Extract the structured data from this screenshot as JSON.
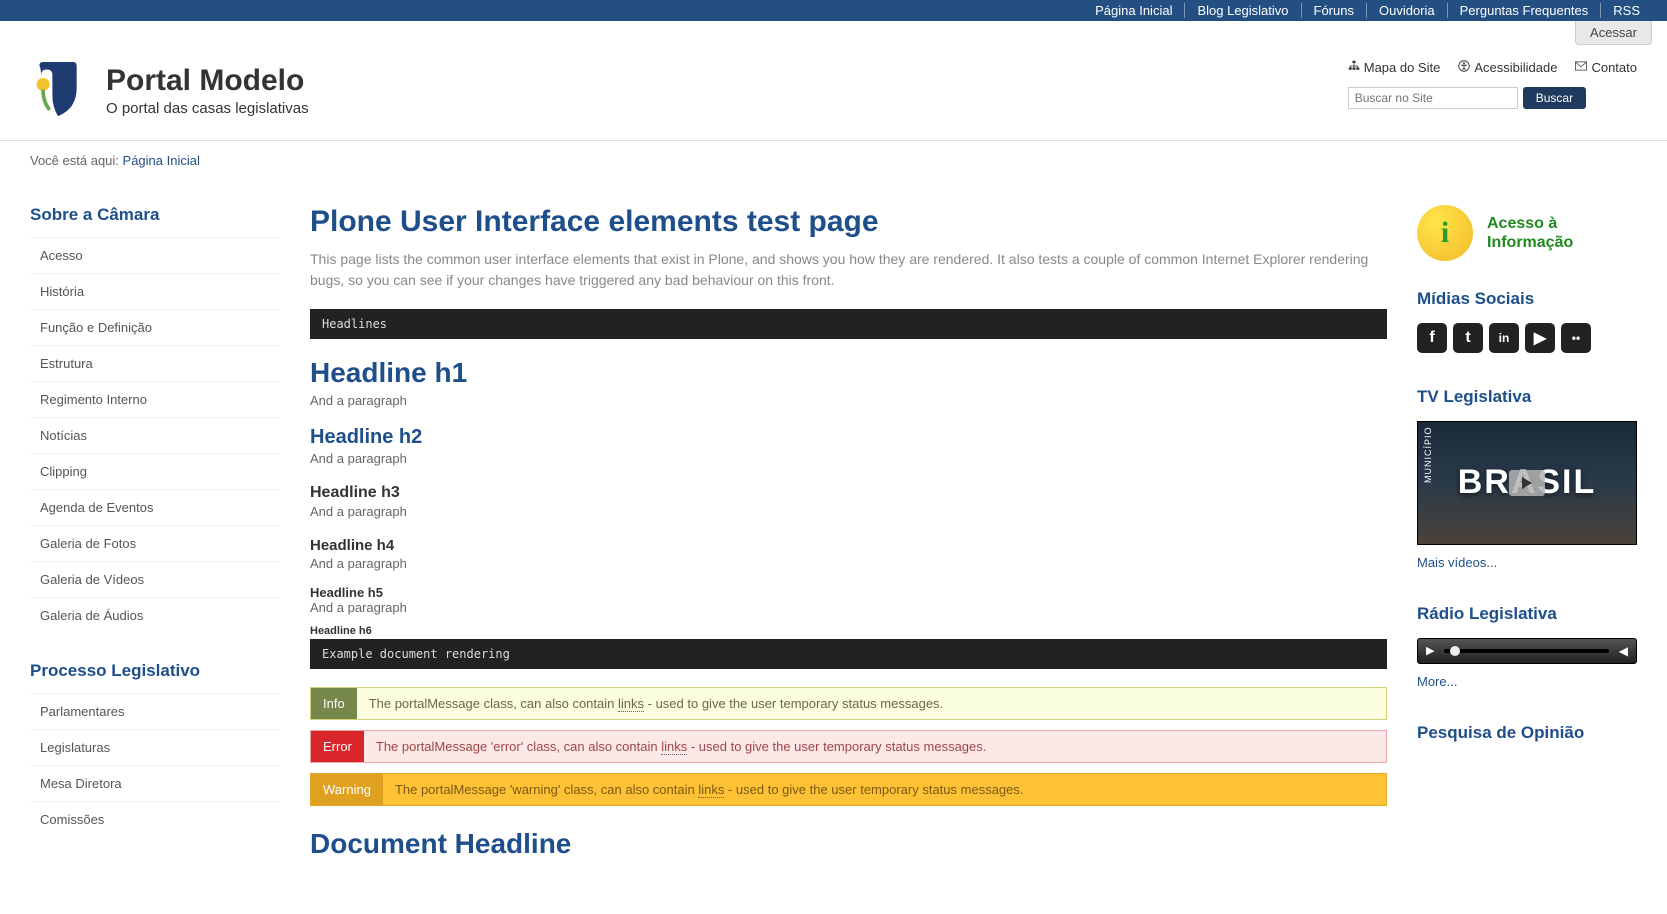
{
  "top_nav": {
    "items": [
      "Página Inicial",
      "Blog Legislativo",
      "Fóruns",
      "Ouvidoria",
      "Perguntas Frequentes",
      "RSS"
    ]
  },
  "acessar_label": "Acessar",
  "brand": {
    "title": "Portal Modelo",
    "subtitle": "O portal das casas legislativas"
  },
  "header_utils": {
    "sitemap": "Mapa do Site",
    "accessibility": "Acessibilidade",
    "contact": "Contato"
  },
  "search": {
    "placeholder": "Buscar no Site",
    "button": "Buscar"
  },
  "breadcrumb": {
    "prefix": "Você está aqui:",
    "home": "Página Inicial"
  },
  "left_nav": {
    "sections": [
      {
        "title": "Sobre a Câmara",
        "items": [
          "Acesso",
          "História",
          "Função e Definição",
          "Estrutura",
          "Regimento Interno",
          "Notícias",
          "Clipping",
          "Agenda de Eventos",
          "Galeria de Fotos",
          "Galeria de Vídeos",
          "Galeria de Áudios"
        ]
      },
      {
        "title": "Processo Legislativo",
        "items": [
          "Parlamentares",
          "Legislaturas",
          "Mesa Diretora",
          "Comissões"
        ]
      }
    ]
  },
  "content": {
    "title": "Plone User Interface elements test page",
    "description": "This page lists the common user interface elements that exist in Plone, and shows you how they are rendered. It also tests a couple of common Internet Explorer rendering bugs, so you can see if your changes have triggered any bad behaviour on this front.",
    "codebar1": "Headlines",
    "h1": "Headline h1",
    "h2": "Headline h2",
    "h3": "Headline h3",
    "h4": "Headline h4",
    "h5": "Headline h5",
    "h6": "Headline h6",
    "para": "And a paragraph",
    "codebar2": "Example document rendering",
    "msgs": {
      "info_label": "Info",
      "info_pre": "The portalMessage class, can also contain ",
      "info_link": "links",
      "info_post": " - used to give the user temporary status messages.",
      "error_label": "Error",
      "error_pre": "The portalMessage 'error' class, can also contain ",
      "error_link": "links",
      "error_post": " - used to give the user temporary status messages.",
      "warning_label": "Warning",
      "warning_pre": "The portalMessage 'warning' class, can also contain ",
      "warning_link": "links",
      "warning_post": " - used to give the user temporary status messages."
    },
    "doc_headline": "Document Headline"
  },
  "right": {
    "info_access_line1": "Acesso à",
    "info_access_line2": "Informação",
    "social_title": "Mídias Sociais",
    "social_icons": [
      "facebook-icon",
      "twitter-icon",
      "linkedin-icon",
      "youtube-icon",
      "flickr-icon"
    ],
    "tv_title": "TV Legislativa",
    "tv_brand_small": "MUNICÍPIO",
    "tv_brand_big": "BRASIL",
    "more_videos": "Mais vídeos...",
    "radio_title": "Rádio Legislativa",
    "more": "More...",
    "poll_title": "Pesquisa de Opinião"
  }
}
